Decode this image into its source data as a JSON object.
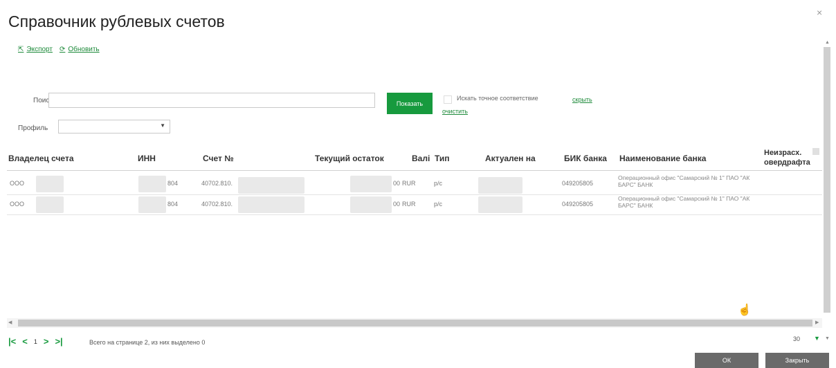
{
  "dialog": {
    "title": "Справочник рублевых счетов",
    "close_icon": "×"
  },
  "toolbar": {
    "export_label": "Экспорт",
    "refresh_label": "Обновить"
  },
  "search": {
    "label": "Поиск",
    "value": "",
    "placeholder": "",
    "show_button": "Показать",
    "exact_match_label": "Искать точное соответствие",
    "exact_match_checked": false,
    "hide_link": "скрыть",
    "clear_link": "очистить"
  },
  "profile": {
    "label": "Профиль",
    "selected": ""
  },
  "table": {
    "columns": [
      "Владелец счета",
      "ИНН",
      "Счет №",
      "Текущий остаток",
      "Валі",
      "Тип",
      "Актуален на",
      "БИК банка",
      "Наименование банка",
      "Неизрасх. овердрафта"
    ],
    "rows": [
      {
        "owner": "ООО",
        "inn": "804",
        "account": "40702.810.",
        "balance": "00",
        "currency": "RUR",
        "type": "р/с",
        "actual_on": "",
        "bik": "049205805",
        "bank_name": "Операционный офис \"Самарский № 1\" ПАО \"АК БАРС\" БАНК"
      },
      {
        "owner": "ООО",
        "inn": "804",
        "account": "40702.810.",
        "balance": "00",
        "currency": "RUR",
        "type": "р/с",
        "actual_on": "",
        "bik": "049205805",
        "bank_name": "Операционный офис \"Самарский № 1\" ПАО \"АК БАРС\" БАНК"
      }
    ]
  },
  "pager": {
    "current_page": "1",
    "info": "Всего на странице 2, из них выделено 0",
    "page_size": "30"
  },
  "footer": {
    "ok_label": "ОК",
    "close_label": "Закрыть"
  }
}
